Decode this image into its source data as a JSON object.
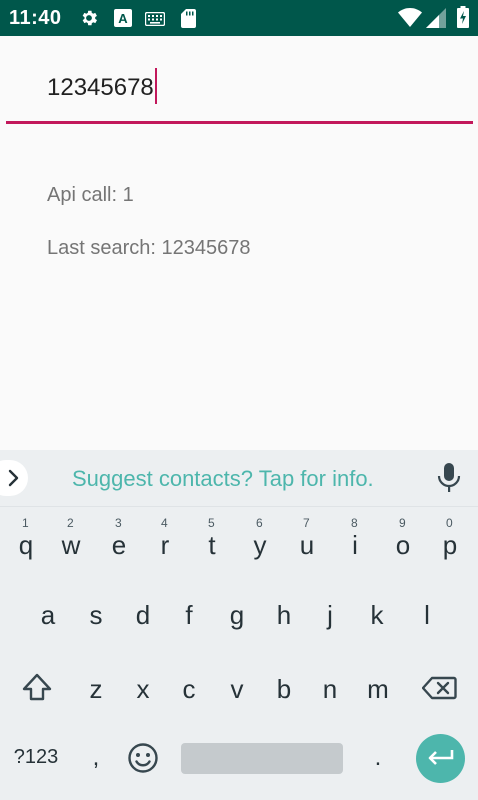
{
  "status_bar": {
    "time": "11:40",
    "left_icons": [
      "gear-icon",
      "keyboard-a-icon",
      "keyboard-icon",
      "sd-card-icon"
    ],
    "right_icons": [
      "wifi-icon",
      "cellular-signal-icon",
      "battery-charging-icon"
    ],
    "background": "#00574b"
  },
  "search": {
    "value": "12345678",
    "accent_color": "#c2185b"
  },
  "info": {
    "api_calls": "Api call: 1",
    "last_search": "Last search: 12345678"
  },
  "keyboard": {
    "suggestion_text": "Suggest contacts? Tap for info.",
    "row1": [
      {
        "key": "q",
        "hint": "1"
      },
      {
        "key": "w",
        "hint": "2"
      },
      {
        "key": "e",
        "hint": "3"
      },
      {
        "key": "r",
        "hint": "4"
      },
      {
        "key": "t",
        "hint": "5"
      },
      {
        "key": "y",
        "hint": "6"
      },
      {
        "key": "u",
        "hint": "7"
      },
      {
        "key": "i",
        "hint": "8"
      },
      {
        "key": "o",
        "hint": "9"
      },
      {
        "key": "p",
        "hint": "0"
      }
    ],
    "row2": [
      "a",
      "s",
      "d",
      "f",
      "g",
      "h",
      "j",
      "k",
      "l"
    ],
    "row3": [
      "z",
      "x",
      "c",
      "v",
      "b",
      "n",
      "m"
    ],
    "symbols_label": "?123",
    "comma_label": ",",
    "period_label": ".",
    "accent_color": "#4db6ac"
  }
}
